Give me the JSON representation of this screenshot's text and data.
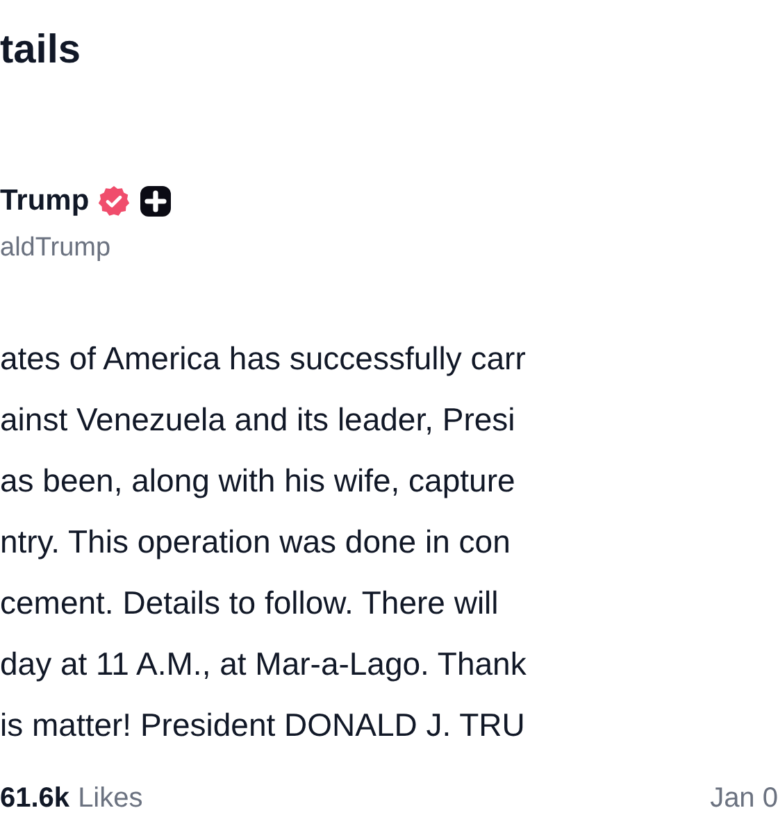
{
  "header": {
    "title": "tails"
  },
  "author": {
    "name": "Trump",
    "verified": true,
    "handle": "aldTrump"
  },
  "post": {
    "lines": [
      "ates of America has successfully carr",
      "ainst Venezuela and its leader, Presi",
      "as been, along with his wife, capture",
      "ntry. This operation was done in con",
      "cement. Details to follow. There will",
      "day at 11 A.M., at Mar-a-Lago. Thank",
      "is matter! President DONALD J. TRU"
    ]
  },
  "stats": {
    "likes_count": "61.6k",
    "likes_label": "Likes",
    "date": "Jan 0"
  }
}
